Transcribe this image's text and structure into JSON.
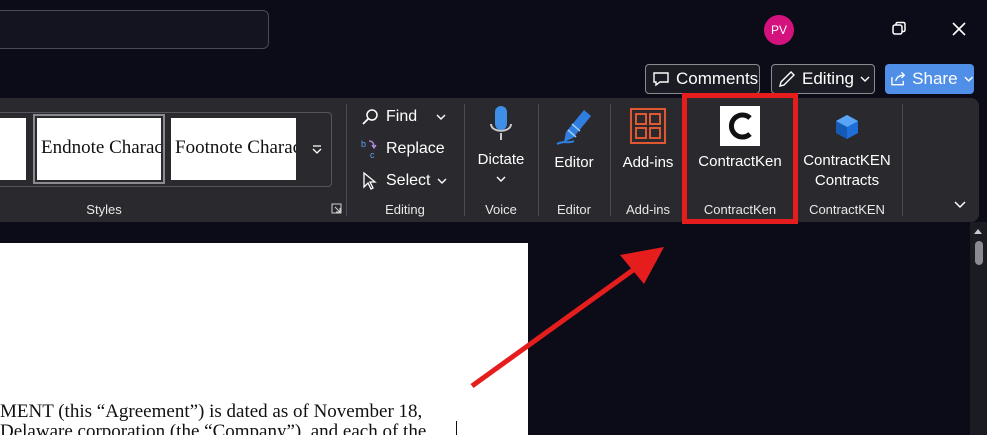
{
  "titlebar": {
    "avatar_initials": "PV"
  },
  "actions": {
    "comments_label": "Comments",
    "editing_label": "Editing",
    "share_label": "Share"
  },
  "ribbon": {
    "styles": {
      "tiles": [
        "Endnote Character",
        "Footnote Character"
      ],
      "group_label": "Styles"
    },
    "editing": {
      "find_label": "Find",
      "replace_label": "Replace",
      "select_label": "Select",
      "group_label": "Editing"
    },
    "voice": {
      "button_label": "Dictate",
      "group_label": "Voice"
    },
    "editor": {
      "button_label": "Editor",
      "group_label": "Editor"
    },
    "addins": {
      "button_label": "Add-ins",
      "group_label": "Add-ins"
    },
    "contractken": {
      "button_label": "ContractKen",
      "group_label": "ContractKen"
    },
    "contractken_contracts": {
      "button_label_line1": "ContractKEN",
      "button_label_line2": "Contracts",
      "group_label": "ContractKEN"
    }
  },
  "document": {
    "line1": "MENT (this “Agreement”) is dated as of November 18,",
    "line2": "Delaware corporation (the “Company”), and each of the"
  },
  "colors": {
    "highlight": "#e51d1d",
    "share_bg": "#4f8fe8",
    "avatar_bg": "#d4127e"
  }
}
